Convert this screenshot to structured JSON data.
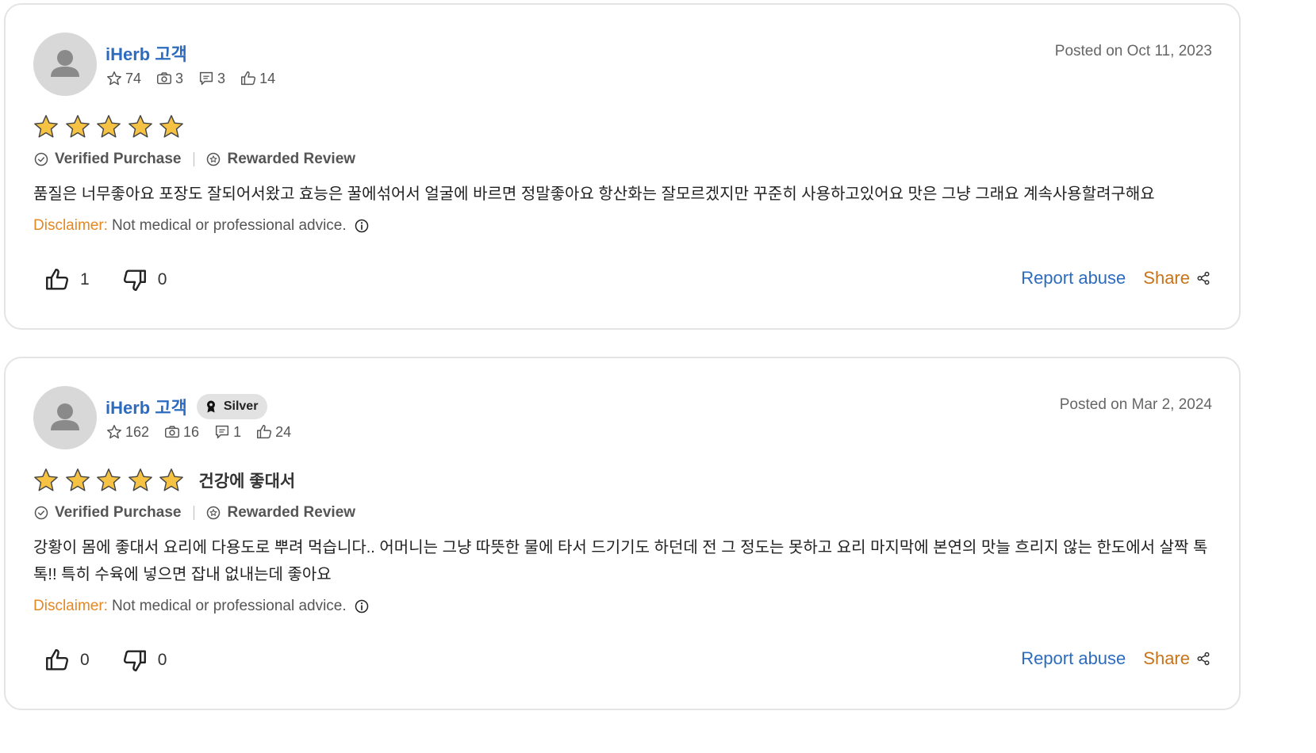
{
  "reviews": [
    {
      "username": "iHerb 고객",
      "tier": "",
      "stats": {
        "stars": "74",
        "photos": "3",
        "comments": "3",
        "likes": "14"
      },
      "posted": "Posted on Oct 11, 2023",
      "rating": 5,
      "title": "",
      "verified_label": "Verified Purchase",
      "rewarded_label": "Rewarded Review",
      "body": "품질은 너무좋아요 포장도 잘되어서왔고 효능은 꿀에섞어서 얼굴에 바르면 정말좋아요 항산화는 잘모르겠지만 꾸준히 사용하고있어요 맛은 그냥 그래요 계속사용할려구해요",
      "disclaimer_label": "Disclaimer:",
      "disclaimer_text": "Not medical or professional advice.",
      "helpful_count": "1",
      "unhelpful_count": "0",
      "report_label": "Report abuse",
      "share_label": "Share"
    },
    {
      "username": "iHerb 고객",
      "tier": "Silver",
      "stats": {
        "stars": "162",
        "photos": "16",
        "comments": "1",
        "likes": "24"
      },
      "posted": "Posted on Mar 2, 2024",
      "rating": 5,
      "title": "건강에 좋대서",
      "verified_label": "Verified Purchase",
      "rewarded_label": "Rewarded Review",
      "body": "강황이 몸에 좋대서 요리에 다용도로 뿌려 먹습니다.. 어머니는 그냥 따뜻한 물에 타서 드기기도 하던데 전 그 정도는 못하고 요리 마지막에 본연의 맛늘 흐리지 않는 한도에서 살짝 톡톡!! 특히 수육에 넣으면 잡내 없내는데 좋아요",
      "disclaimer_label": "Disclaimer:",
      "disclaimer_text": "Not medical or professional advice.",
      "helpful_count": "0",
      "unhelpful_count": "0",
      "report_label": "Report abuse",
      "share_label": "Share"
    }
  ],
  "colors": {
    "link_blue": "#2d6bbf",
    "accent_orange": "#e8871e",
    "star_gold": "#f5c243",
    "avatar_gray": "#d8d8d8"
  },
  "icons": {
    "avatar": "person-silhouette-icon",
    "tier": "award-ribbon-icon",
    "stat_stars": "star-outline-icon",
    "stat_photos": "camera-icon",
    "stat_comments": "comment-icon",
    "stat_likes": "thumbs-up-outline-icon",
    "verified": "check-circle-icon",
    "rewarded": "reward-badge-icon",
    "disclaimer_info": "info-icon",
    "helpful": "thumbs-up-icon",
    "unhelpful": "thumbs-down-icon",
    "share": "share-icon"
  }
}
